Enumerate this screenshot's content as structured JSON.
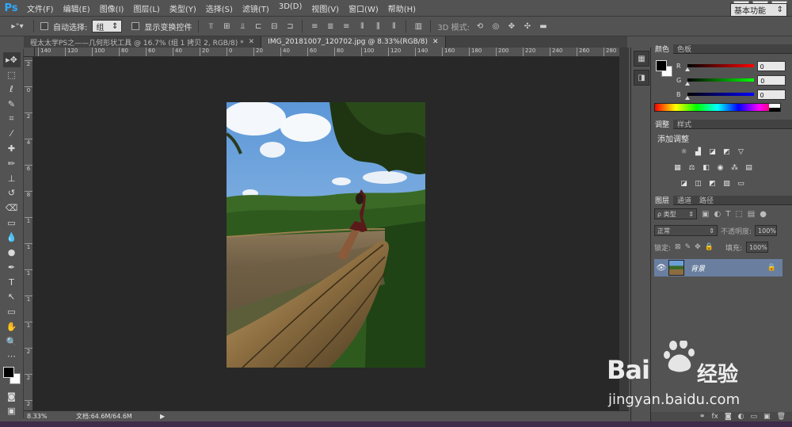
{
  "app": {
    "logo": "Ps"
  },
  "menu": [
    "文件(F)",
    "编辑(E)",
    "图像(I)",
    "图层(L)",
    "类型(Y)",
    "选择(S)",
    "滤镜(T)",
    "3D(D)",
    "视图(V)",
    "窗口(W)",
    "帮助(H)"
  ],
  "window_controls": {
    "minimize": "—",
    "restore": "❐",
    "close": "✕"
  },
  "options": {
    "auto_select_label": "自动选择:",
    "auto_select_value": "组",
    "show_transform_label": "显示变换控件",
    "mode_3d_label": "3D 模式:",
    "workspace": "基本功能"
  },
  "tabs": [
    {
      "title": "程太太学PS之——几何形状工具 @ 16.7% (组 1 拷贝 2, RGB/8) *",
      "close": "✕"
    },
    {
      "title": "IMG_20181007_120702.jpg @ 8.33%(RGB/8)",
      "close": "✕"
    }
  ],
  "ruler": {
    "h_labels": [
      "140",
      "120",
      "100",
      "80",
      "60",
      "40",
      "20",
      "0",
      "20",
      "40",
      "60",
      "80",
      "100",
      "120",
      "140",
      "160",
      "180",
      "200",
      "220",
      "240",
      "260",
      "280"
    ],
    "v_labels": [
      "2",
      "0",
      "2",
      "4",
      "6",
      "8",
      "1",
      "1",
      "1",
      "1",
      "1",
      "2",
      "2",
      "2"
    ]
  },
  "status": {
    "zoom": "8.33%",
    "doc": "文档:64.6M/64.6M",
    "arrow": "▶"
  },
  "color_panel": {
    "tabs": [
      "颜色",
      "色板"
    ],
    "channels": [
      {
        "label": "R",
        "value": "0",
        "from": "#000000",
        "to": "#ff0000"
      },
      {
        "label": "G",
        "value": "0",
        "from": "#000000",
        "to": "#00ff00"
      },
      {
        "label": "B",
        "value": "0",
        "from": "#000000",
        "to": "#0000ff"
      }
    ]
  },
  "adjust_panel": {
    "tabs": [
      "调整",
      "样式"
    ],
    "heading": "添加调整"
  },
  "layers_panel": {
    "tabs": [
      "图层",
      "通道",
      "路径"
    ],
    "filter_label": "ρ 类型",
    "blend_mode": "正常",
    "opacity_label": "不透明度:",
    "opacity_value": "100%",
    "lock_label": "锁定:",
    "fill_label": "填充:",
    "fill_value": "100%",
    "layer_name": "背景"
  },
  "watermark": {
    "brand": "Bai",
    "brand_cn": "经验",
    "url": "jingyan.baidu.com"
  }
}
